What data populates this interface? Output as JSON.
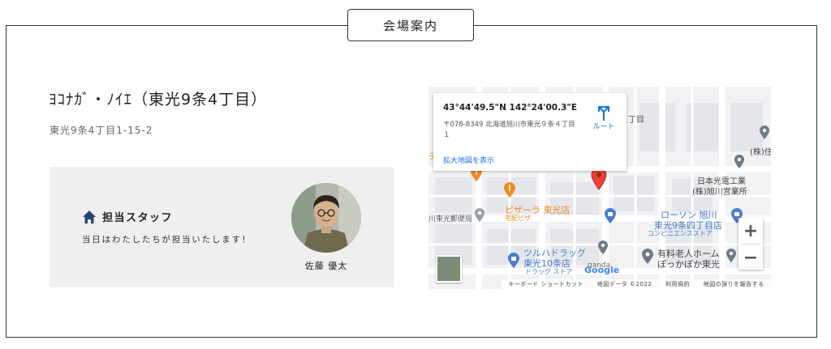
{
  "section": {
    "title": "会場案内"
  },
  "venue": {
    "name": "ﾖｺﾅｶﾞ・ﾉｲｴ（東光9条4丁目）",
    "address": "東光9条4丁目1-15-2"
  },
  "staff": {
    "title": "担当スタッフ",
    "message": "当日はわたしたちが担当いたします！",
    "name": "佐藤 優太",
    "icon": "home-icon"
  },
  "map": {
    "coords": "43°44'49.5\"N 142°24'00.3\"E",
    "address": "〒078-8349 北海道旭川市東光９条４丁目１",
    "enlarge_link": "拡大地図を表示",
    "route_label": "ルート",
    "zoom_in": "+",
    "zoom_out": "−",
    "google_logo": "Google",
    "labels": {
      "sumi": "(株)住",
      "nihon_1": "日本光電工業",
      "nihon_2": "(株)旭川営業所",
      "pizzala": "ピザーラ 東光店",
      "pizzala_sub": "宅配ピザ",
      "post": "川東光郵便局",
      "lawson_1": "ローソン 旭川",
      "lawson_2": "東光9条四丁目店",
      "lawson_sub": "コンビニエンスストア",
      "tsuruha_1": "ツルハドラッグ",
      "tsuruha_2": "東光10条店",
      "tsuruha_sub": "ドラッグ ストア",
      "rojin_1": "有料老人ホーム",
      "rojin_2": "ぽっかぽか東光",
      "chome": "丁目",
      "te": "テ",
      "ganda": "ganda"
    },
    "footer": {
      "shortcuts": "キーボード ショートカット",
      "map_data": "地図データ ©2022",
      "terms": "利用規約",
      "report": "地図の誤りを報告する"
    },
    "colors": {
      "pin": "#ea4335",
      "link": "#1a73e8",
      "poi_blue": "#4a7bd0",
      "poi_orange": "#f08a24",
      "poi_gray": "#6f7b85"
    }
  }
}
